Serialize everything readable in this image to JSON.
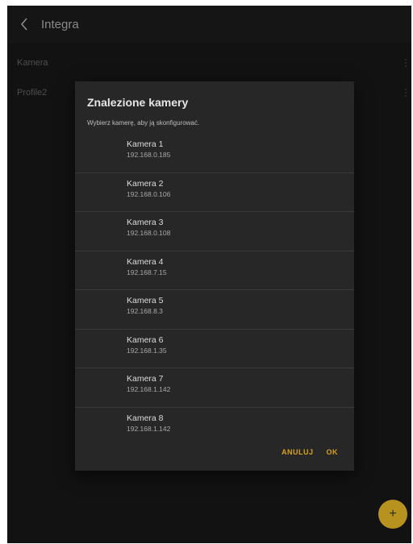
{
  "appbar": {
    "title": "Integra",
    "back_icon": "chevron-left-icon"
  },
  "list": [
    {
      "label": "Kamera",
      "menu_icon": "more-vertical-icon"
    },
    {
      "label": "Profile2",
      "menu_icon": "more-vertical-icon"
    }
  ],
  "dialog": {
    "title": "Znalezione kamery",
    "subtitle": "Wybierz kamerę, aby ją skonfigurować.",
    "cameras": [
      {
        "name": "Kamera 1",
        "ip": "192.168.0.185"
      },
      {
        "name": "Kamera 2",
        "ip": "192.168.0.106"
      },
      {
        "name": "Kamera 3",
        "ip": "192.168.0.108"
      },
      {
        "name": "Kamera 4",
        "ip": "192.168.7.15"
      },
      {
        "name": "Kamera 5",
        "ip": "192.168.8.3"
      },
      {
        "name": "Kamera 6",
        "ip": "192.168.1.35"
      },
      {
        "name": "Kamera 7",
        "ip": "192.168.1.142"
      },
      {
        "name": "Kamera 8",
        "ip": "192.168.1.142"
      }
    ],
    "cancel_label": "ANULUJ",
    "ok_label": "OK"
  },
  "fab": {
    "label": "+",
    "icon": "plus-icon"
  },
  "colors": {
    "accent": "#d6a21e",
    "fab": "#b8921f",
    "dialog_bg": "#272727",
    "app_bg": "#121212"
  }
}
